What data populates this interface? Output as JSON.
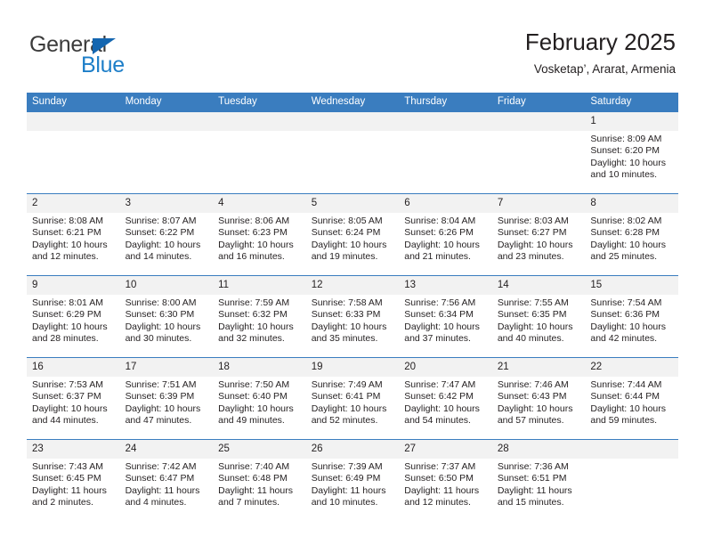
{
  "brand": {
    "name_part1": "General",
    "name_part2": "Blue",
    "triangle_color": "#1466b0",
    "blue_color": "#1d7ec8"
  },
  "header": {
    "title": "February 2025",
    "subtitle": "Vosketap’, Ararat, Armenia"
  },
  "theme": {
    "header_blue": "#3a7dbf",
    "day_band_gray": "#f2f2f2",
    "text_color": "#231f20"
  },
  "calendar": {
    "weekday_headers": [
      "Sunday",
      "Monday",
      "Tuesday",
      "Wednesday",
      "Thursday",
      "Friday",
      "Saturday"
    ],
    "weeks": [
      [
        {
          "day": "",
          "blank": true
        },
        {
          "day": "",
          "blank": true
        },
        {
          "day": "",
          "blank": true
        },
        {
          "day": "",
          "blank": true
        },
        {
          "day": "",
          "blank": true
        },
        {
          "day": "",
          "blank": true
        },
        {
          "day": "1",
          "sunrise": "Sunrise: 8:09 AM",
          "sunset": "Sunset: 6:20 PM",
          "daylight": "Daylight: 10 hours and 10 minutes."
        }
      ],
      [
        {
          "day": "2",
          "sunrise": "Sunrise: 8:08 AM",
          "sunset": "Sunset: 6:21 PM",
          "daylight": "Daylight: 10 hours and 12 minutes."
        },
        {
          "day": "3",
          "sunrise": "Sunrise: 8:07 AM",
          "sunset": "Sunset: 6:22 PM",
          "daylight": "Daylight: 10 hours and 14 minutes."
        },
        {
          "day": "4",
          "sunrise": "Sunrise: 8:06 AM",
          "sunset": "Sunset: 6:23 PM",
          "daylight": "Daylight: 10 hours and 16 minutes."
        },
        {
          "day": "5",
          "sunrise": "Sunrise: 8:05 AM",
          "sunset": "Sunset: 6:24 PM",
          "daylight": "Daylight: 10 hours and 19 minutes."
        },
        {
          "day": "6",
          "sunrise": "Sunrise: 8:04 AM",
          "sunset": "Sunset: 6:26 PM",
          "daylight": "Daylight: 10 hours and 21 minutes."
        },
        {
          "day": "7",
          "sunrise": "Sunrise: 8:03 AM",
          "sunset": "Sunset: 6:27 PM",
          "daylight": "Daylight: 10 hours and 23 minutes."
        },
        {
          "day": "8",
          "sunrise": "Sunrise: 8:02 AM",
          "sunset": "Sunset: 6:28 PM",
          "daylight": "Daylight: 10 hours and 25 minutes."
        }
      ],
      [
        {
          "day": "9",
          "sunrise": "Sunrise: 8:01 AM",
          "sunset": "Sunset: 6:29 PM",
          "daylight": "Daylight: 10 hours and 28 minutes."
        },
        {
          "day": "10",
          "sunrise": "Sunrise: 8:00 AM",
          "sunset": "Sunset: 6:30 PM",
          "daylight": "Daylight: 10 hours and 30 minutes."
        },
        {
          "day": "11",
          "sunrise": "Sunrise: 7:59 AM",
          "sunset": "Sunset: 6:32 PM",
          "daylight": "Daylight: 10 hours and 32 minutes."
        },
        {
          "day": "12",
          "sunrise": "Sunrise: 7:58 AM",
          "sunset": "Sunset: 6:33 PM",
          "daylight": "Daylight: 10 hours and 35 minutes."
        },
        {
          "day": "13",
          "sunrise": "Sunrise: 7:56 AM",
          "sunset": "Sunset: 6:34 PM",
          "daylight": "Daylight: 10 hours and 37 minutes."
        },
        {
          "day": "14",
          "sunrise": "Sunrise: 7:55 AM",
          "sunset": "Sunset: 6:35 PM",
          "daylight": "Daylight: 10 hours and 40 minutes."
        },
        {
          "day": "15",
          "sunrise": "Sunrise: 7:54 AM",
          "sunset": "Sunset: 6:36 PM",
          "daylight": "Daylight: 10 hours and 42 minutes."
        }
      ],
      [
        {
          "day": "16",
          "sunrise": "Sunrise: 7:53 AM",
          "sunset": "Sunset: 6:37 PM",
          "daylight": "Daylight: 10 hours and 44 minutes."
        },
        {
          "day": "17",
          "sunrise": "Sunrise: 7:51 AM",
          "sunset": "Sunset: 6:39 PM",
          "daylight": "Daylight: 10 hours and 47 minutes."
        },
        {
          "day": "18",
          "sunrise": "Sunrise: 7:50 AM",
          "sunset": "Sunset: 6:40 PM",
          "daylight": "Daylight: 10 hours and 49 minutes."
        },
        {
          "day": "19",
          "sunrise": "Sunrise: 7:49 AM",
          "sunset": "Sunset: 6:41 PM",
          "daylight": "Daylight: 10 hours and 52 minutes."
        },
        {
          "day": "20",
          "sunrise": "Sunrise: 7:47 AM",
          "sunset": "Sunset: 6:42 PM",
          "daylight": "Daylight: 10 hours and 54 minutes."
        },
        {
          "day": "21",
          "sunrise": "Sunrise: 7:46 AM",
          "sunset": "Sunset: 6:43 PM",
          "daylight": "Daylight: 10 hours and 57 minutes."
        },
        {
          "day": "22",
          "sunrise": "Sunrise: 7:44 AM",
          "sunset": "Sunset: 6:44 PM",
          "daylight": "Daylight: 10 hours and 59 minutes."
        }
      ],
      [
        {
          "day": "23",
          "sunrise": "Sunrise: 7:43 AM",
          "sunset": "Sunset: 6:45 PM",
          "daylight": "Daylight: 11 hours and 2 minutes."
        },
        {
          "day": "24",
          "sunrise": "Sunrise: 7:42 AM",
          "sunset": "Sunset: 6:47 PM",
          "daylight": "Daylight: 11 hours and 4 minutes."
        },
        {
          "day": "25",
          "sunrise": "Sunrise: 7:40 AM",
          "sunset": "Sunset: 6:48 PM",
          "daylight": "Daylight: 11 hours and 7 minutes."
        },
        {
          "day": "26",
          "sunrise": "Sunrise: 7:39 AM",
          "sunset": "Sunset: 6:49 PM",
          "daylight": "Daylight: 11 hours and 10 minutes."
        },
        {
          "day": "27",
          "sunrise": "Sunrise: 7:37 AM",
          "sunset": "Sunset: 6:50 PM",
          "daylight": "Daylight: 11 hours and 12 minutes."
        },
        {
          "day": "28",
          "sunrise": "Sunrise: 7:36 AM",
          "sunset": "Sunset: 6:51 PM",
          "daylight": "Daylight: 11 hours and 15 minutes."
        },
        {
          "day": "",
          "blank": true
        }
      ]
    ]
  }
}
